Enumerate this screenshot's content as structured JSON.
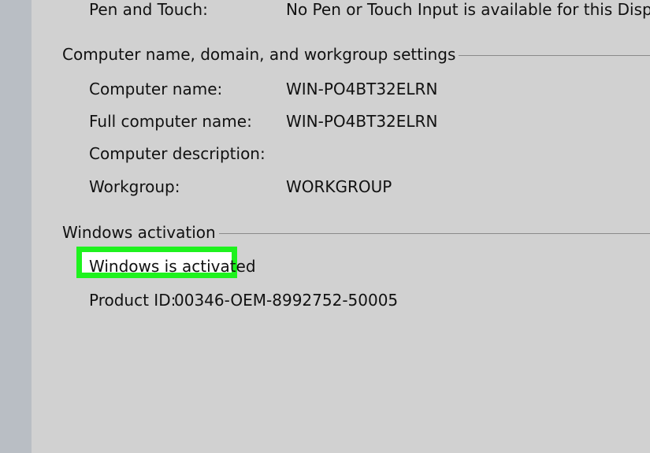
{
  "pen_touch": {
    "label": "Pen and Touch:",
    "value": "No Pen or Touch Input is available for this Display"
  },
  "computer_section": {
    "title": "Computer name, domain, and workgroup settings",
    "rows": [
      {
        "label": "Computer name:",
        "value": "WIN-PO4BT32ELRN"
      },
      {
        "label": "Full computer name:",
        "value": "WIN-PO4BT32ELRN"
      },
      {
        "label": "Computer description:",
        "value": ""
      },
      {
        "label": "Workgroup:",
        "value": "WORKGROUP"
      }
    ]
  },
  "activation_section": {
    "title": "Windows activation",
    "status": "Windows is activated",
    "highlight_color": "#1ef21e",
    "product_id_label": "Product ID:",
    "product_id_value": "00346-OEM-8992752-50005"
  }
}
